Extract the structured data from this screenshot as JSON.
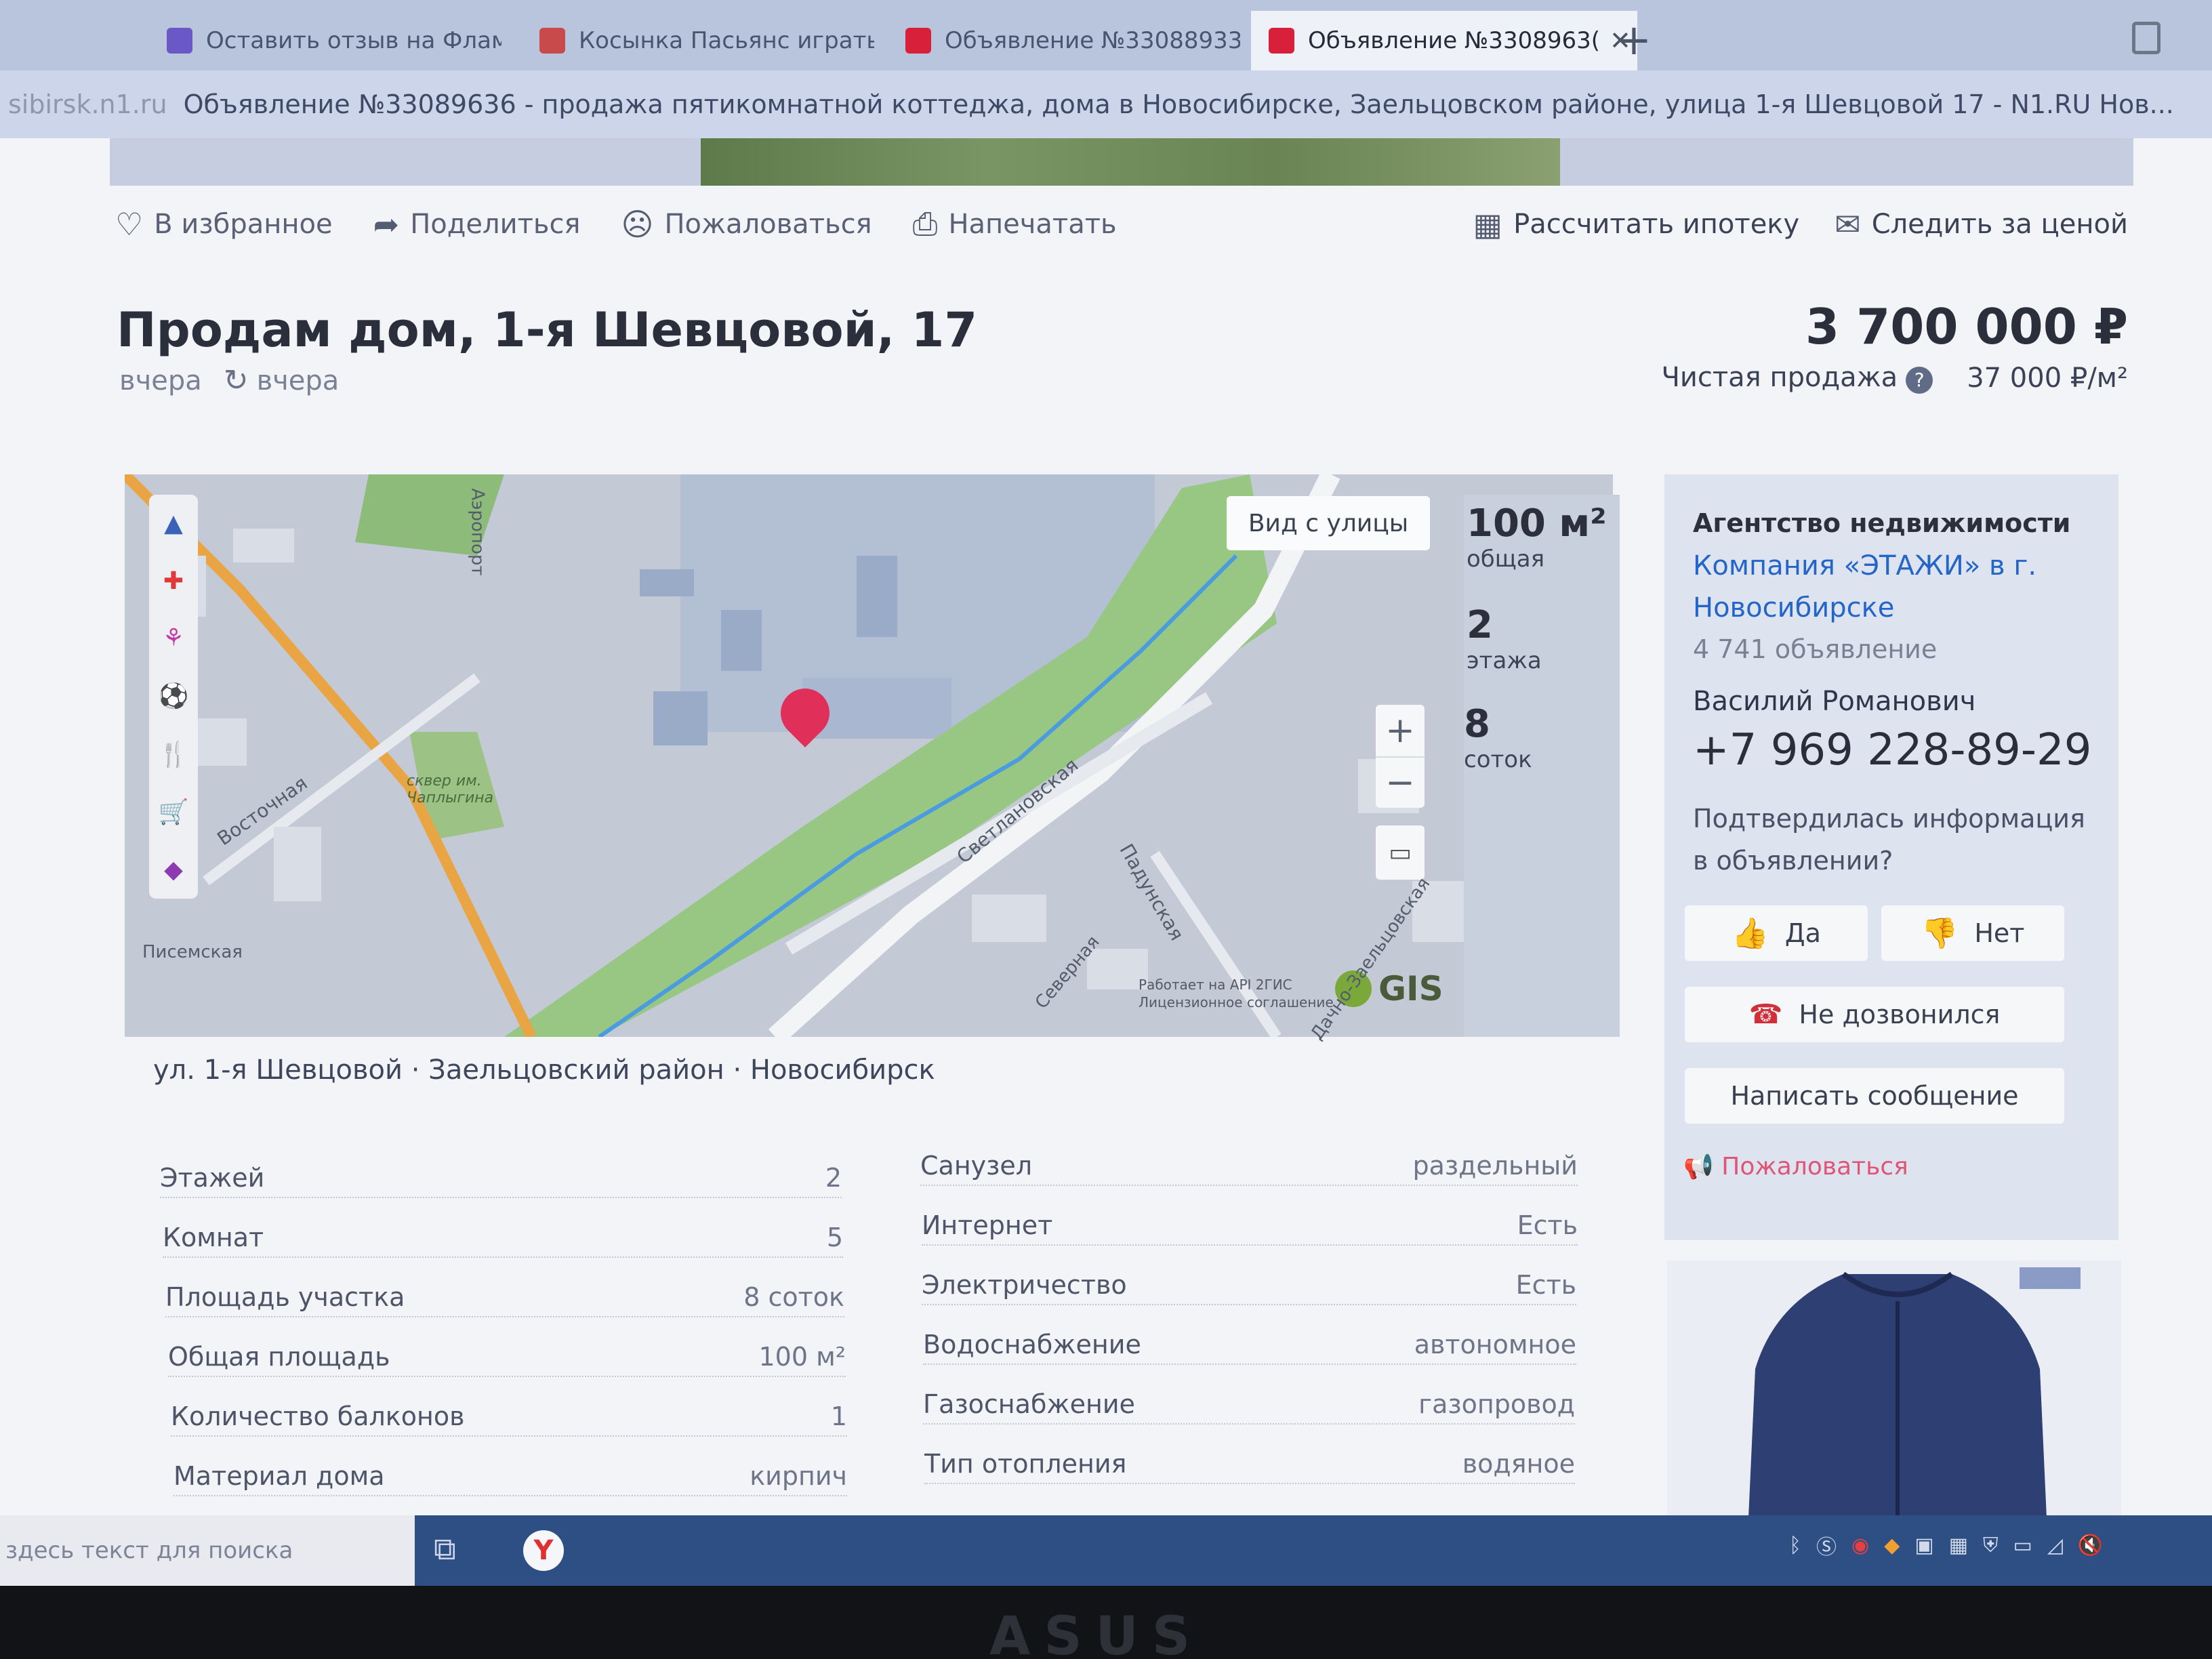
{
  "browser": {
    "tabs": [
      {
        "label": "Оставить отзыв на Флам...",
        "active": false,
        "favicon_color": "#6a58c7"
      },
      {
        "label": "Косынка Пасьянс играть о...",
        "active": false,
        "favicon_color": "#c84a4a"
      },
      {
        "label": "Объявление №33088933 -",
        "active": false,
        "favicon_color": "#d8203a"
      },
      {
        "label": "Объявление №3308963(",
        "active": true,
        "favicon_color": "#d8203a"
      }
    ],
    "new_tab_icon": "plus-icon",
    "page_title_domain": "sibirsk.n1.ru",
    "page_title": "Объявление №33089636 - продажа пятикомнатной коттеджа, дома в Новосибирске, Заельцовском районе, улица 1-я Шевцовой 17 - N1.RU Нов..."
  },
  "actions": {
    "favorite": "В избранное",
    "share": "Поделиться",
    "report": "Пожаловаться",
    "print": "Напечатать",
    "mortgage": "Рассчитать ипотеку",
    "track_price": "Следить за ценой"
  },
  "listing": {
    "title": "Продам дом, 1-я Шевцовой, 17",
    "created": "вчера",
    "updated": "вчера",
    "price": "3 700 000 ₽",
    "sale_type": "Чистая продажа",
    "price_per_m2": "37 000 ₽/м²"
  },
  "map": {
    "street_view_button": "Вид с улицы",
    "zoom_in": "+",
    "zoom_out": "−",
    "provider": "GIS",
    "copyright": "Работает на API 2ГИС Лицензионное соглашение",
    "labels": [
      "Светлановская",
      "Падунская",
      "Северная",
      "Писемская",
      "Восточная",
      "сквер им. Чаплыгина",
      "Аэропорт",
      "Дачно-Заельцовская"
    ]
  },
  "stats": [
    {
      "value": "100 м²",
      "label": "общая"
    },
    {
      "value": "2",
      "label": "этажа"
    },
    {
      "value": "8",
      "label": "соток"
    }
  ],
  "address": "ул. 1-я Шевцовой · Заельцовский район · Новосибирск",
  "specs_left": [
    {
      "label": "Этажей",
      "value": "2"
    },
    {
      "label": "Комнат",
      "value": "5"
    },
    {
      "label": "Площадь участка",
      "value": "8 соток"
    },
    {
      "label": "Общая площадь",
      "value": "100 м²"
    },
    {
      "label": "Количество балконов",
      "value": "1"
    },
    {
      "label": "Материал дома",
      "value": "кирпич"
    }
  ],
  "specs_right": [
    {
      "label": "Санузел",
      "value": "раздельный"
    },
    {
      "label": "Интернет",
      "value": "Есть"
    },
    {
      "label": "Электричество",
      "value": "Есть"
    },
    {
      "label": "Водоснабжение",
      "value": "автономное"
    },
    {
      "label": "Газоснабжение",
      "value": "газопровод"
    },
    {
      "label": "Тип отопления",
      "value": "водяное"
    }
  ],
  "agency": {
    "heading": "Агентство недвижимости",
    "name_line1": "Компания «ЭТАЖИ» в г.",
    "name_line2": "Новосибирске",
    "count": "4 741 объявление",
    "contact": "Василий Романович",
    "phone": "+7 969 228-89-29",
    "question_line1": "Подтвердилась информация",
    "question_line2": "в объявлении?",
    "yes": "Да",
    "no": "Нет",
    "no_answer": "Не дозвонился",
    "message": "Написать сообщение",
    "complain": "Пожаловаться",
    "link_color": "#2465c8",
    "complain_color": "#e05575"
  },
  "taskbar": {
    "search_placeholder": "здесь текст для поиска",
    "yandex_letter": "Y"
  },
  "hardware": {
    "brand": "ASUS"
  }
}
